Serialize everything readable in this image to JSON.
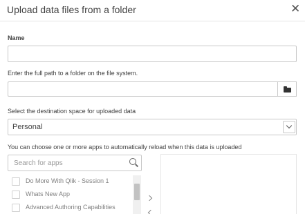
{
  "dialog": {
    "title": "Upload data files from a folder",
    "close_symbol": "✕"
  },
  "name_field": {
    "label": "Name",
    "value": ""
  },
  "path_field": {
    "label": "Enter the full path to a folder on the file system.",
    "value": "",
    "browse_icon": "folder-icon"
  },
  "space_field": {
    "label": "Select the destination space for uploaded data",
    "selected": "Personal"
  },
  "apps": {
    "label": "You can choose one or more apps to automatically reload when this data is uploaded",
    "search_placeholder": "Search for apps",
    "items": [
      {
        "label": "Do More With Qlik - Session 1",
        "checked": false
      },
      {
        "label": "Whats New App",
        "checked": false
      },
      {
        "label": "Advanced Authoring Capabilities",
        "checked": false
      }
    ]
  }
}
